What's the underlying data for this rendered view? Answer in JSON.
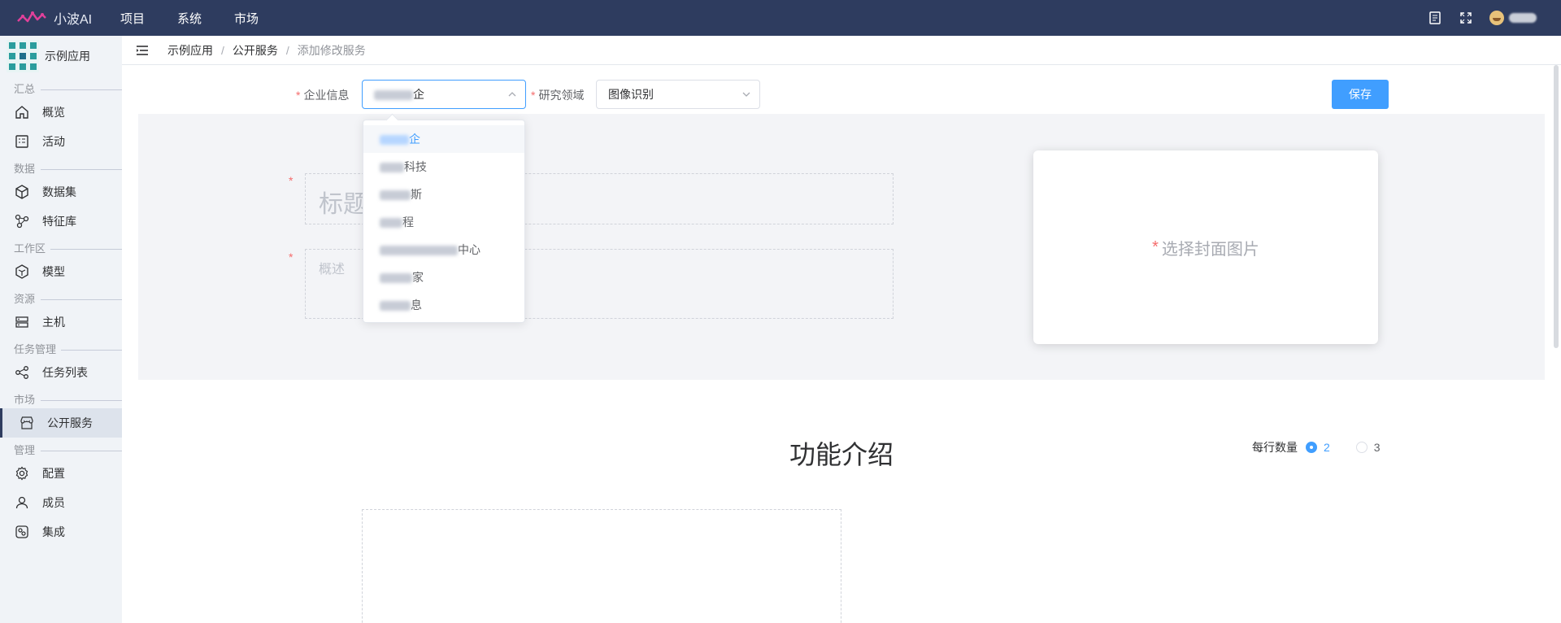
{
  "app": {
    "brand": "小波AI",
    "top_nav": [
      "项目",
      "系统",
      "市场"
    ]
  },
  "sidebar": {
    "app_name": "示例应用",
    "groups": [
      {
        "title": "汇总",
        "items": [
          {
            "label": "概览",
            "icon": "home-icon"
          },
          {
            "label": "活动",
            "icon": "checklist-icon"
          }
        ]
      },
      {
        "title": "数据",
        "items": [
          {
            "label": "数据集",
            "icon": "cube-icon"
          },
          {
            "label": "特征库",
            "icon": "network-icon"
          }
        ]
      },
      {
        "title": "工作区",
        "items": [
          {
            "label": "模型",
            "icon": "hexagon-icon"
          }
        ]
      },
      {
        "title": "资源",
        "items": [
          {
            "label": "主机",
            "icon": "server-icon"
          }
        ]
      },
      {
        "title": "任务管理",
        "items": [
          {
            "label": "任务列表",
            "icon": "share-nodes-icon"
          }
        ]
      },
      {
        "title": "市场",
        "items": [
          {
            "label": "公开服务",
            "icon": "store-icon",
            "active": true
          }
        ]
      },
      {
        "title": "管理",
        "items": [
          {
            "label": "配置",
            "icon": "gear-icon"
          },
          {
            "label": "成员",
            "icon": "user-icon"
          },
          {
            "label": "集成",
            "icon": "integration-icon"
          }
        ]
      }
    ]
  },
  "breadcrumb": [
    "示例应用",
    "公开服务",
    "添加修改服务"
  ],
  "form": {
    "company_label": "企业信息",
    "company_value_suffix": "企",
    "field_label": "研究领域",
    "field_value": "图像识别",
    "save_label": "保存"
  },
  "dropdown": {
    "options": [
      {
        "suffix": "企",
        "selected": true
      },
      {
        "suffix": "科技"
      },
      {
        "suffix": "斯"
      },
      {
        "suffix": "程"
      },
      {
        "suffix": "中心"
      },
      {
        "suffix": "家"
      },
      {
        "suffix": "息"
      }
    ]
  },
  "hero": {
    "title_placeholder": "标题",
    "desc_placeholder": "概述",
    "cover_label": "选择封面图片"
  },
  "features": {
    "title": "功能介绍",
    "per_row_label": "每行数量",
    "options": [
      "2",
      "3"
    ],
    "selected": "2"
  },
  "colors": {
    "topbar": "#2e3c5f",
    "primary": "#409eff",
    "required": "#f56c6c"
  }
}
